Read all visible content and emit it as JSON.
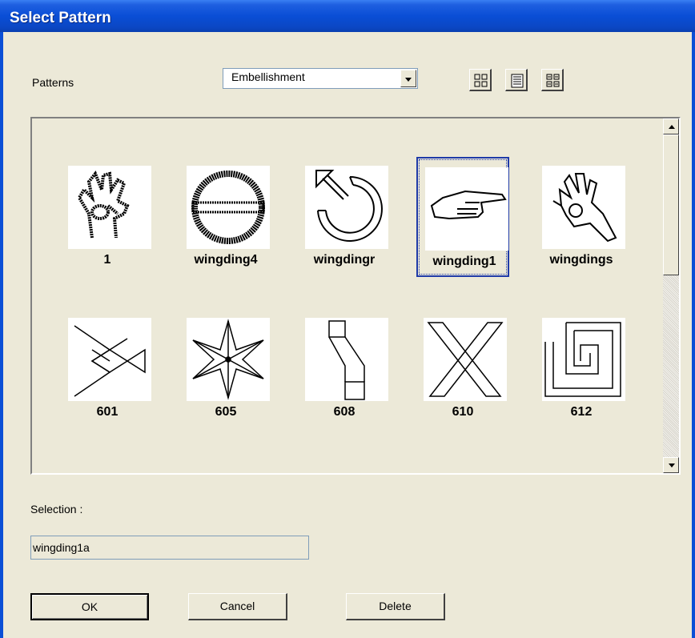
{
  "window": {
    "title": "Select Pattern"
  },
  "patterns_label": "Patterns",
  "category_select": {
    "value": "Embellishment"
  },
  "view_buttons": [
    {
      "icon": "large-icons-icon"
    },
    {
      "icon": "list-view-icon"
    },
    {
      "icon": "small-icons-icon"
    }
  ],
  "patterns": [
    {
      "name": "1",
      "icon": "hand-gesture-icon",
      "selected": false
    },
    {
      "name": "wingding4",
      "icon": "circle-bar-icon",
      "selected": false
    },
    {
      "name": "wingdingr",
      "icon": "circular-arrow-icon",
      "selected": false
    },
    {
      "name": "wingding1",
      "icon": "pointing-hand-icon",
      "selected": true
    },
    {
      "name": "wingdings",
      "icon": "ok-hand-icon",
      "selected": false
    },
    {
      "name": "601",
      "icon": "diamond-chain-icon",
      "selected": false
    },
    {
      "name": "605",
      "icon": "star-icon",
      "selected": false
    },
    {
      "name": "608",
      "icon": "zigzag-squares-icon",
      "selected": false
    },
    {
      "name": "610",
      "icon": "x-cross-icon",
      "selected": false
    },
    {
      "name": "612",
      "icon": "spiral-icon",
      "selected": false
    }
  ],
  "selection_label": "Selection :",
  "selection_value": "wingding1a",
  "buttons": {
    "ok": "OK",
    "cancel": "Cancel",
    "delete": "Delete"
  }
}
